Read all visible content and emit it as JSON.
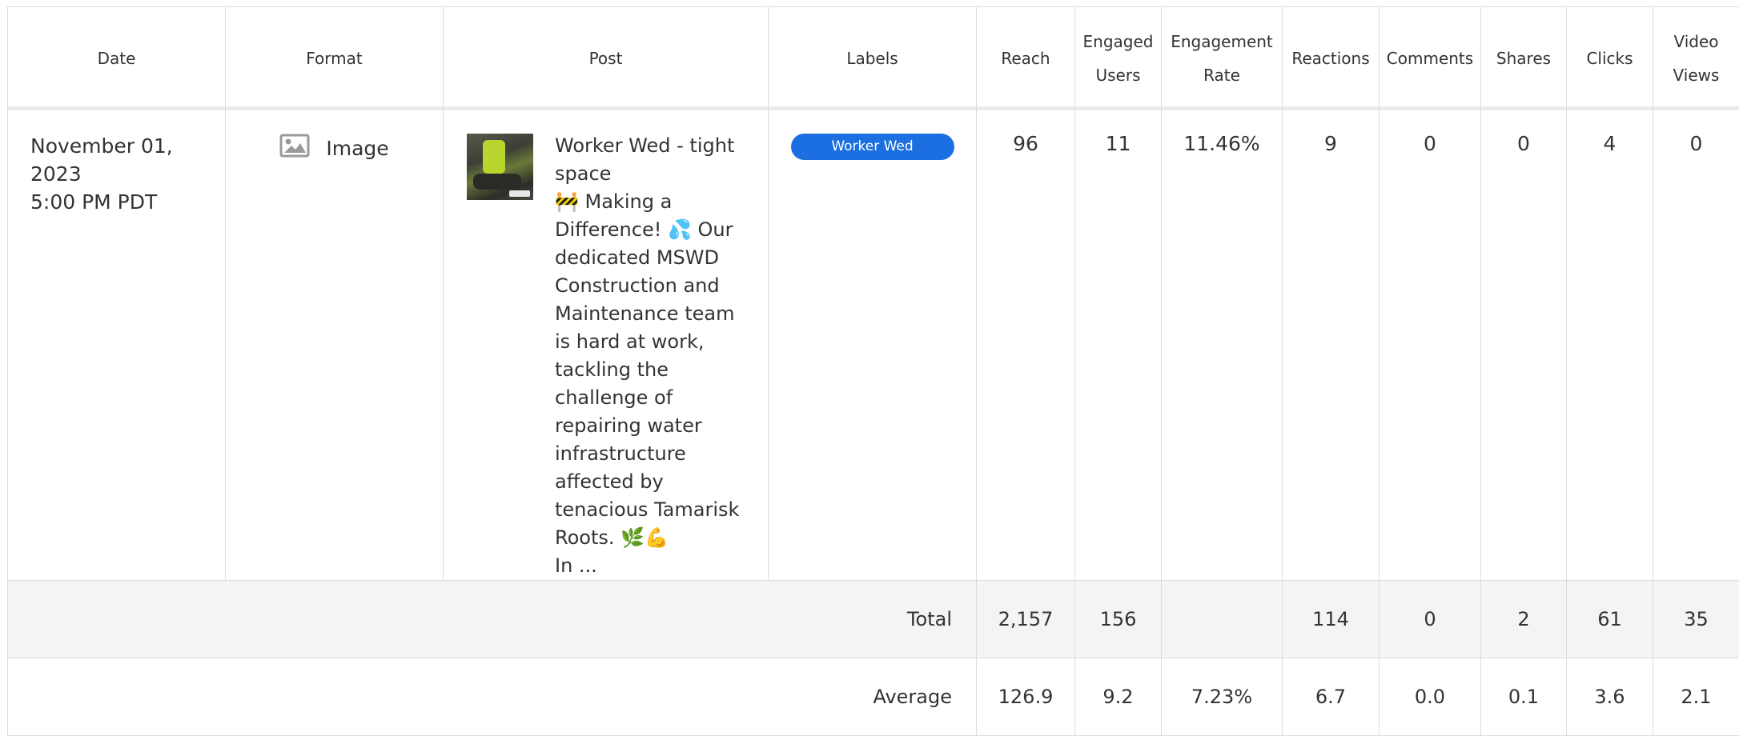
{
  "columns": {
    "date": "Date",
    "format": "Format",
    "post": "Post",
    "labels": "Labels",
    "reach": "Reach",
    "engaged_users_1": "Engaged",
    "engaged_users_2": "Users",
    "engagement_rate_1": "Engagement",
    "engagement_rate_2": "Rate",
    "reactions": "Reactions",
    "comments": "Comments",
    "shares": "Shares",
    "clicks": "Clicks",
    "video_views_1": "Video",
    "video_views_2": "Views"
  },
  "row": {
    "date_line1": "November 01, 2023",
    "date_line2": "5:00 PM PDT",
    "format": "Image",
    "format_icon": "image-icon",
    "post_text": "Worker Wed - tight space\n🚧 Making a Difference! 💦 Our dedicated MSWD Construction and Maintenance team is hard at work, tackling the challenge of repairing water infrastructure affected by tenacious Tamarisk Roots. 🌿💪\nIn ...",
    "label": "Worker Wed",
    "label_color": "#1b6fe0",
    "reach": "96",
    "engaged_users": "11",
    "engagement_rate": "11.46%",
    "reactions": "9",
    "comments": "0",
    "shares": "0",
    "clicks": "4",
    "video_views": "0"
  },
  "total": {
    "label": "Total",
    "reach": "2,157",
    "engaged_users": "156",
    "engagement_rate": "",
    "reactions": "114",
    "comments": "0",
    "shares": "2",
    "clicks": "61",
    "video_views": "35"
  },
  "average": {
    "label": "Average",
    "reach": "126.9",
    "engaged_users": "9.2",
    "engagement_rate": "7.23%",
    "reactions": "6.7",
    "comments": "0.0",
    "shares": "0.1",
    "clicks": "3.6",
    "video_views": "2.1"
  }
}
